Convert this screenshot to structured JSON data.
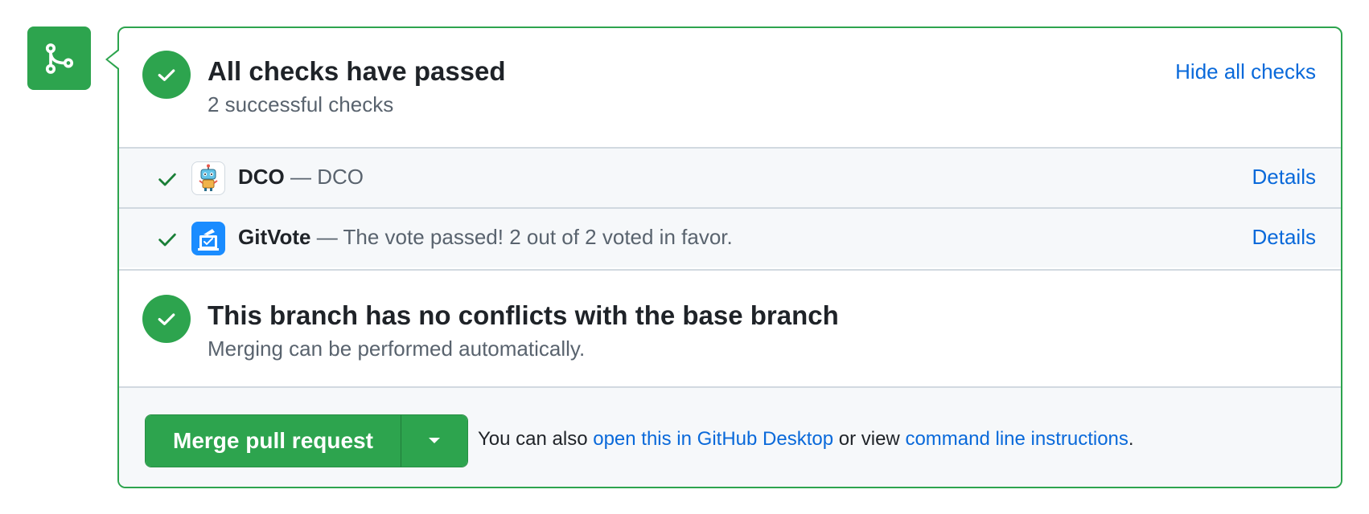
{
  "checks": {
    "title": "All checks have passed",
    "subtitle": "2 successful checks",
    "hide_link": "Hide all checks",
    "items": [
      {
        "name": "DCO",
        "separator": "—",
        "description": "DCO",
        "details": "Details",
        "avatar_icon": "robot-icon"
      },
      {
        "name": "GitVote",
        "separator": "—",
        "description": "The vote passed! 2 out of 2 voted in favor.",
        "details": "Details",
        "avatar_icon": "ballot-box-icon"
      }
    ]
  },
  "conflicts": {
    "title": "This branch has no conflicts with the base branch",
    "subtitle": "Merging can be performed automatically."
  },
  "merge": {
    "button_label": "Merge pull request",
    "hint_prefix": "You can also",
    "desktop_link": "open this in GitHub Desktop",
    "hint_middle": "or view",
    "cli_link": "command line instructions",
    "hint_suffix": "."
  },
  "colors": {
    "success": "#2da44e",
    "link": "#0969da",
    "muted": "#59636e",
    "subtle_bg": "#f6f8fa"
  }
}
